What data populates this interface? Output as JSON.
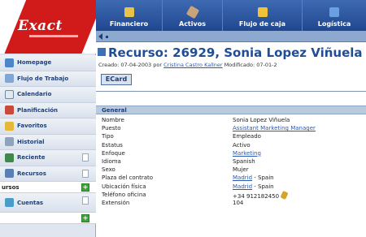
{
  "logo": {
    "text": "Exact"
  },
  "sidebar": {
    "items": [
      {
        "label": "Homepage",
        "icon": "home-icon"
      },
      {
        "label": "Flujo de Trabajo",
        "icon": "workflow-icon"
      },
      {
        "label": "Calendario",
        "icon": "calendar-icon"
      },
      {
        "label": "Planificación",
        "icon": "planning-icon"
      },
      {
        "label": "Favoritos",
        "icon": "favorites-icon"
      },
      {
        "label": "Historial",
        "icon": "history-icon"
      },
      {
        "label": "Reciente",
        "icon": "recent-icon"
      },
      {
        "label": "Recursos",
        "icon": "resources-icon"
      },
      {
        "label": "Cuentas",
        "icon": "accounts-icon"
      }
    ],
    "sub_label": "ursos"
  },
  "topnav": {
    "items": [
      {
        "label": "Financiero",
        "icon": "money-bag-icon"
      },
      {
        "label": "Activos",
        "icon": "tools-icon"
      },
      {
        "label": "Flujo de caja",
        "icon": "cash-box-icon"
      },
      {
        "label": "Logística",
        "icon": "logistics-icon"
      }
    ]
  },
  "page": {
    "title": "Recurso: 26929, Sonia Lopez Viñuela",
    "meta_prefix": "Creado: 07-04-2003 por",
    "meta_creator": "Cristina Castro Kallner",
    "meta_suffix": "Modificado: 07-01-2",
    "card_button": "ECard"
  },
  "section": {
    "title": "General",
    "fields": [
      {
        "label": "Nombre",
        "value": "Sonia Lopez Viñuela",
        "link": false
      },
      {
        "label": "Puesto",
        "value": "Assistant Marketing Manager",
        "link": true
      },
      {
        "label": "Tipo",
        "value": "Empleado",
        "link": false
      },
      {
        "label": "Estatus",
        "value": "Activo",
        "link": false
      },
      {
        "label": "Enfoque",
        "value": "Marketing",
        "link": true
      },
      {
        "label": "Idioma",
        "value": "Spanish",
        "link": false
      },
      {
        "label": "Sexo",
        "value": "Mujer",
        "link": false
      },
      {
        "label": "Plaza del contrato",
        "value": "Madrid",
        "suffix": " - Spain",
        "link": true
      },
      {
        "label": "Ubicación física",
        "value": "Madrid",
        "suffix": " - Spain",
        "link": true
      },
      {
        "label": "Teléfono oficina",
        "value": "+34 912182450",
        "link": false
      },
      {
        "label": "Extensión",
        "value": "104",
        "link": false
      }
    ]
  },
  "colors": {
    "nav_blue": "#1f4790",
    "title_blue": "#1f4e96",
    "logo_red": "#d11b1b",
    "link_blue": "#2b58b0"
  }
}
